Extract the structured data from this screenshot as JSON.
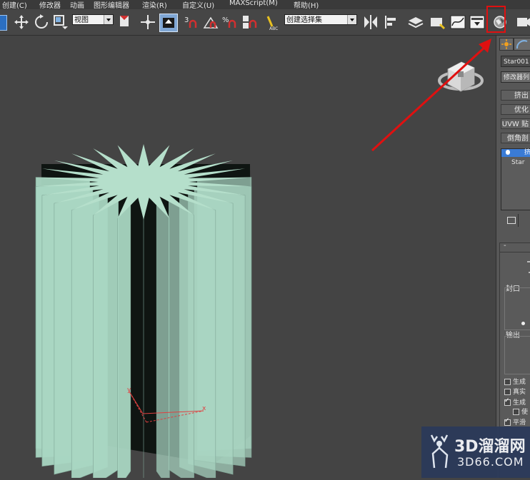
{
  "menu": [
    {
      "label": "创建(C)"
    },
    {
      "label": "修改器"
    },
    {
      "label": "动画"
    },
    {
      "label": "图形编辑器"
    },
    {
      "label": "渲染(R)"
    },
    {
      "label": "自定义(U)"
    },
    {
      "label": "MAXScript(M)"
    },
    {
      "label": "帮助(H)"
    }
  ],
  "toolbar": {
    "reference_coord": "视图",
    "selection_set": "创建选择集",
    "icons": [
      "select-icon",
      "move-icon",
      "rotate-icon",
      "scale-icon",
      "snap-icon",
      "angle-snap-icon",
      "percent-snap-icon",
      "spinner-snap-icon",
      "edit-named-selection-icon",
      "mirror-icon",
      "align-icon",
      "layer-manager-icon",
      "curve-editor-icon",
      "schematic-view-icon",
      "material-editor-icon",
      "render-setup-icon"
    ]
  },
  "viewport": {
    "axis_x": "x",
    "axis_y": "y"
  },
  "command_panel": {
    "object_name": "Star001",
    "modifier_list": "修改器列",
    "buttons": [
      "挤出",
      "优化",
      "UVW 贴",
      "倒角剖"
    ],
    "stack_items": [
      {
        "label": "挤"
      },
      {
        "label": "Star"
      }
    ],
    "rollout_title": "-",
    "group_cap": "封口",
    "group_output": "输出",
    "checkboxes": [
      {
        "label": "生成",
        "checked": false
      },
      {
        "label": "真实",
        "checked": false
      },
      {
        "label": "生成",
        "checked": true
      },
      {
        "label": "使",
        "checked": false
      },
      {
        "label": "平滑",
        "checked": true
      }
    ]
  },
  "watermark": {
    "brand": "3D溜溜网",
    "url": "3D66.COM"
  },
  "colors": {
    "viewport_bg": "#444444",
    "object": "#a9d6c2",
    "annotation": "#e01010"
  }
}
